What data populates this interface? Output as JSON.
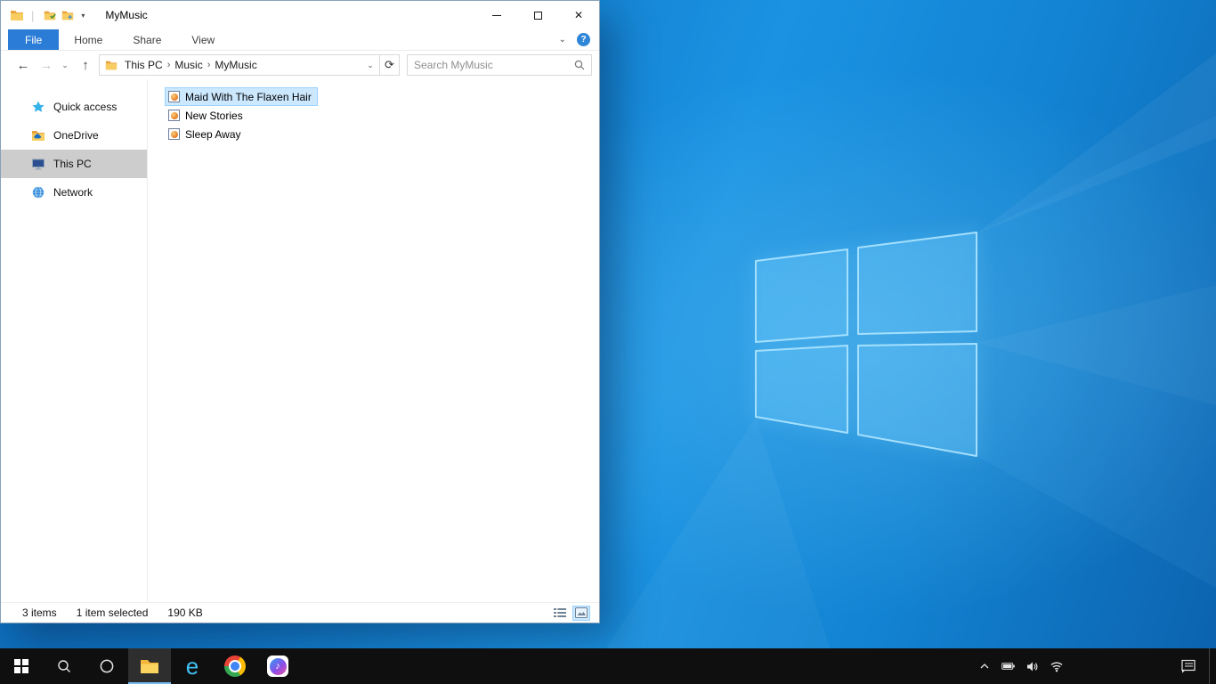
{
  "colors": {
    "accent": "#0078d7",
    "file-tab": "#2b7cd6",
    "selection-bg": "#cce8ff",
    "selection-border": "#99d1ff",
    "sidebar-selected": "#cdcdcd",
    "taskbar-bg": "#0f0f0f",
    "desktop-base": "#1180cf"
  },
  "icons": {
    "back": "←",
    "forward": "→",
    "history_dropdown": "⌄",
    "up": "↑",
    "address_dropdown": "⌄",
    "refresh": "⟳",
    "crumb_separator": "›",
    "qat_separator": "|",
    "qat_dropdown": "▾",
    "ribbon_collapse": "⌄",
    "help": "?",
    "close": "✕",
    "ie_letter": "e",
    "itunes_note": "♪"
  },
  "explorer": {
    "title": "MyMusic",
    "tabs": {
      "file": "File",
      "home": "Home",
      "share": "Share",
      "view": "View"
    },
    "breadcrumb": {
      "root": "This PC",
      "parent": "Music",
      "current": "MyMusic"
    },
    "search_placeholder": "Search MyMusic",
    "sidebar": {
      "quick_access": "Quick access",
      "onedrive": "OneDrive",
      "this_pc": "This PC",
      "network": "Network"
    },
    "files": {
      "file1": "Maid With The Flaxen Hair",
      "file2": "New Stories",
      "file3": "Sleep Away"
    },
    "status": {
      "count": "3 items",
      "selection": "1 item selected",
      "size": "190 KB"
    }
  }
}
